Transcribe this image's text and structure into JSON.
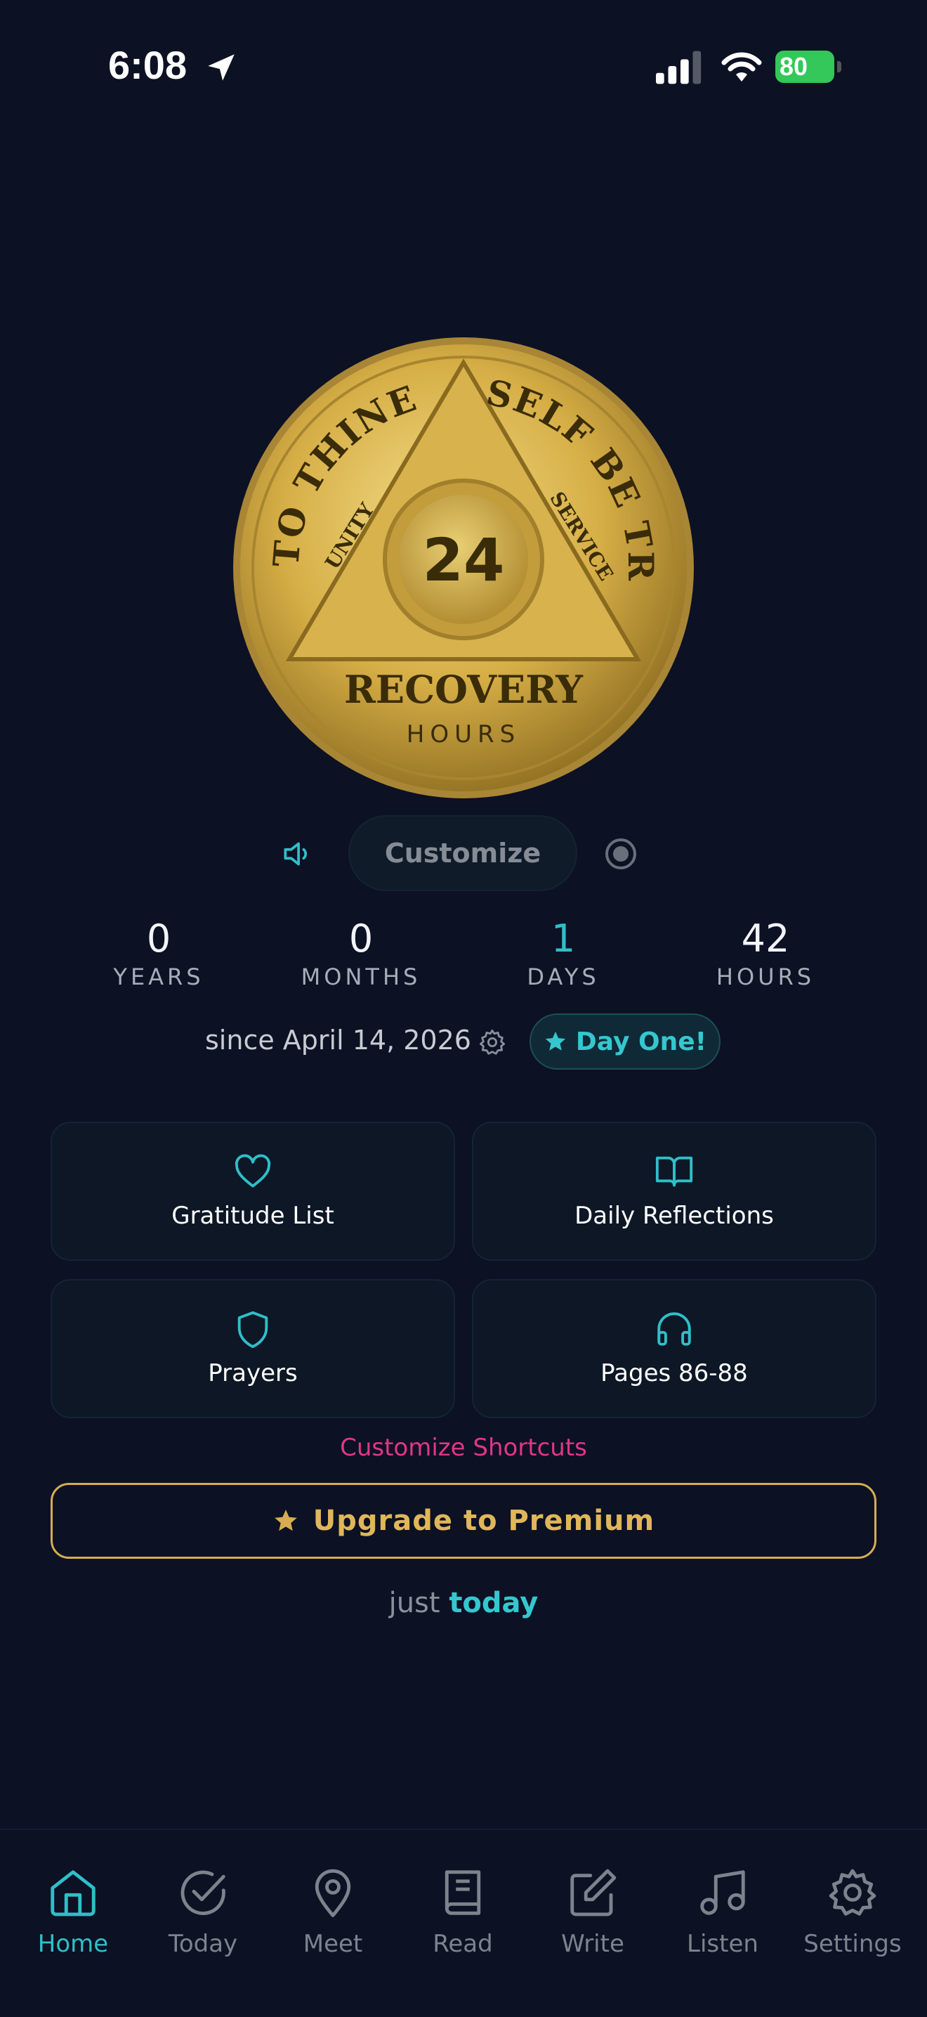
{
  "status_bar": {
    "time": "6:08",
    "battery": "80"
  },
  "coin": {
    "top_left_text": "TO THINE OWN",
    "top_right_text": "SELF BE TRUE",
    "left_inner": "UNITY",
    "right_inner": "SERVICE",
    "number": "24",
    "main": "RECOVERY",
    "unit": "HOURS"
  },
  "controls": {
    "customize_label": "Customize"
  },
  "counters": [
    {
      "value": "0",
      "label": "YEARS"
    },
    {
      "value": "0",
      "label": "MONTHS"
    },
    {
      "value": "1",
      "label": "DAYS"
    },
    {
      "value": "42",
      "label": "HOURS"
    }
  ],
  "since_text": "since April 14, 2026",
  "milestone_badge": "Day One!",
  "shortcuts": [
    {
      "label": "Gratitude List",
      "icon": "heart-icon"
    },
    {
      "label": "Daily Reflections",
      "icon": "book-icon"
    },
    {
      "label": "Prayers",
      "icon": "shield-icon"
    },
    {
      "label": "Pages 86-88",
      "icon": "headphones-icon"
    }
  ],
  "customize_shortcuts": "Customize Shortcuts",
  "premium_label": "Upgrade to Premium",
  "just_prefix": "just",
  "just_emphasis": "today",
  "tabs": [
    {
      "label": "Home",
      "icon": "home-icon",
      "active": true
    },
    {
      "label": "Today",
      "icon": "check-circle-icon"
    },
    {
      "label": "Meet",
      "icon": "map-pin-icon"
    },
    {
      "label": "Read",
      "icon": "book-icon"
    },
    {
      "label": "Write",
      "icon": "edit-icon"
    },
    {
      "label": "Listen",
      "icon": "music-icon"
    },
    {
      "label": "Settings",
      "icon": "gear-icon"
    }
  ],
  "colors": {
    "background": "#0c1124",
    "accent": "#2fbfc8",
    "gold": "#d6ad52",
    "pink": "#e0368a"
  }
}
